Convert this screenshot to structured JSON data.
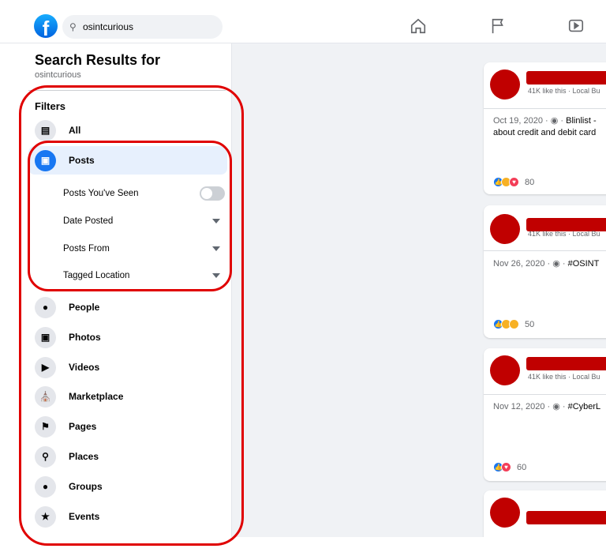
{
  "header": {
    "search_value": "osintcurious",
    "nav": [
      "home-icon",
      "flag-icon",
      "watch-icon"
    ]
  },
  "sidebar": {
    "title": "Search Results for",
    "query": "osintcurious",
    "filters_label": "Filters",
    "items": [
      {
        "label": "All",
        "icon": "feed-icon"
      },
      {
        "label": "Posts",
        "icon": "posts-icon",
        "active": true
      },
      {
        "label": "People",
        "icon": "people-icon"
      },
      {
        "label": "Photos",
        "icon": "photos-icon"
      },
      {
        "label": "Videos",
        "icon": "video-icon"
      },
      {
        "label": "Marketplace",
        "icon": "marketplace-icon"
      },
      {
        "label": "Pages",
        "icon": "flag-icon"
      },
      {
        "label": "Places",
        "icon": "pin-icon"
      },
      {
        "label": "Groups",
        "icon": "groups-icon"
      },
      {
        "label": "Events",
        "icon": "events-icon"
      }
    ],
    "post_filters": {
      "seen": "Posts You've Seen",
      "seen_on": false,
      "date": "Date Posted",
      "from": "Posts From",
      "location": "Tagged Location"
    }
  },
  "posts": [
    {
      "meta": "41K like this · Local Bu",
      "date": "Oct 19, 2020 · ",
      "author": "Blinlist -",
      "body": "about credit and debit card",
      "reactions": [
        "like",
        "wow",
        "love"
      ],
      "count": "80"
    },
    {
      "meta": "41K like this · Local Bu",
      "date": "Nov 26, 2020 · ",
      "author": "#OSINT",
      "body": "",
      "reactions": [
        "like",
        "haha",
        "wow"
      ],
      "count": "50"
    },
    {
      "meta": "41K like this · Local Bu",
      "date": "Nov 12, 2020 · ",
      "author": "#CyberL",
      "body": "",
      "reactions": [
        "like",
        "love"
      ],
      "count": "60"
    }
  ],
  "colors": {
    "accent": "#1877f2",
    "annotation": "#e00000",
    "redaction": "#c00000"
  }
}
